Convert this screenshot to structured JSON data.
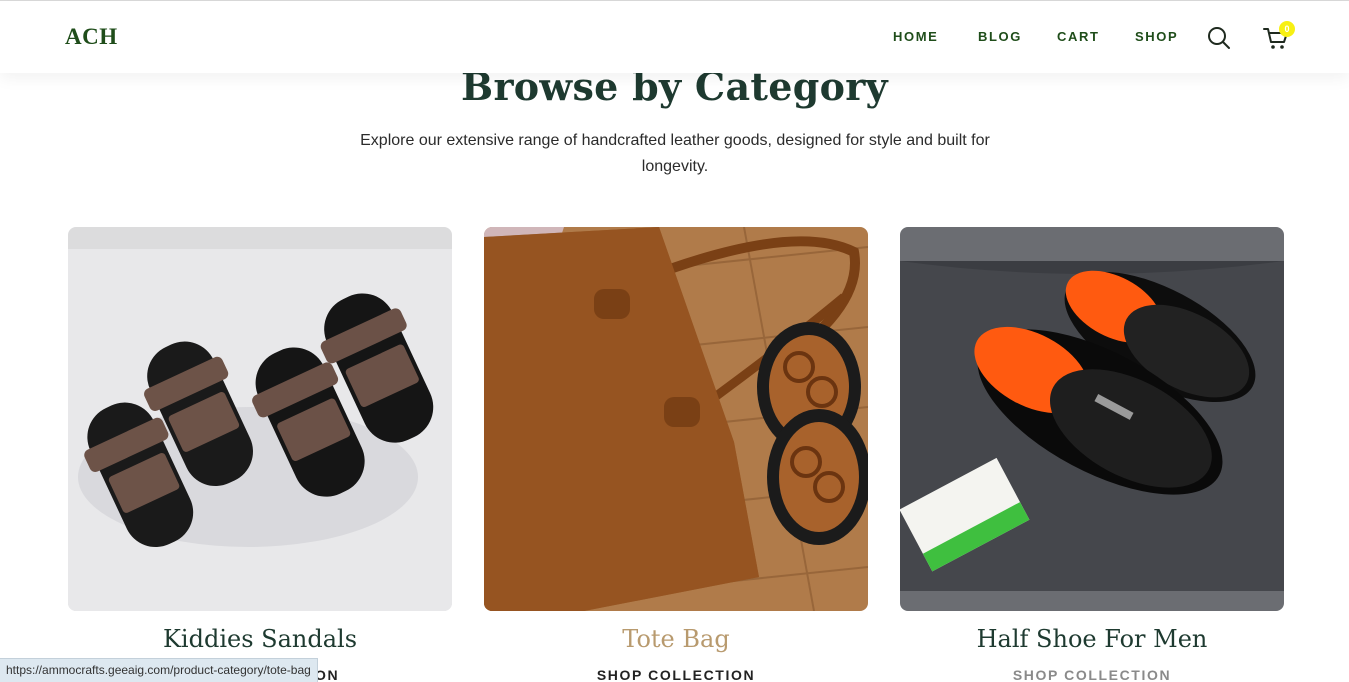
{
  "header": {
    "logo": "ACH",
    "nav": [
      "HOME",
      "BLOG",
      "CART",
      "SHOP"
    ],
    "cart_count": "0",
    "icons": [
      "search-icon",
      "cart-icon"
    ]
  },
  "section": {
    "title": "Browse by Category",
    "subtitle": "Explore our extensive range of handcrafted leather goods, designed for style and built for longevity."
  },
  "categories": [
    {
      "name": "Kiddies Sandals",
      "link": "SHOP COLLECTION"
    },
    {
      "name": "Tote Bag",
      "link": "SHOP COLLECTION"
    },
    {
      "name": "Half Shoe For Men",
      "link": "SHOP COLLECTION"
    }
  ],
  "status_bar": {
    "url": "https://ammocrafts.geeaig.com/product-category/tote-bag"
  },
  "colors": {
    "brand_green": "#1f4d1a",
    "title": "#1e3a30",
    "hover_gold": "#b89a6e",
    "badge": "#f7f013"
  }
}
